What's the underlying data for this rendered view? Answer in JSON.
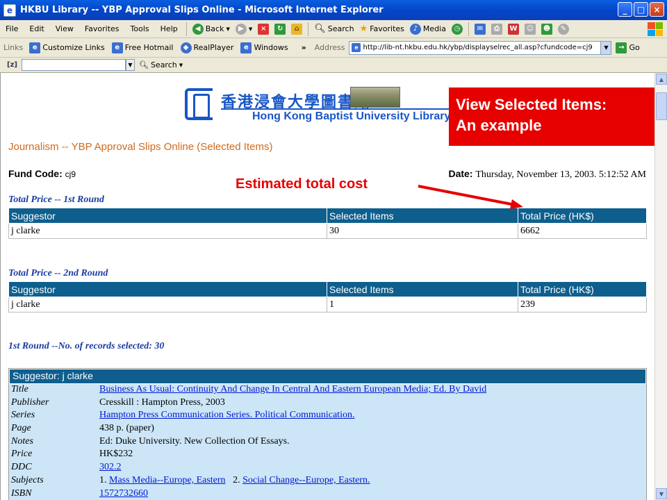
{
  "window": {
    "title": "HKBU Library -- YBP Approval Slips Online - Microsoft Internet Explorer",
    "controls": [
      "_",
      "□",
      "×"
    ]
  },
  "menubar": {
    "menus": [
      "File",
      "Edit",
      "View",
      "Favorites",
      "Tools",
      "Help"
    ],
    "toolbar": {
      "back": "Back",
      "search": "Search",
      "favorites": "Favorites",
      "media": "Media"
    }
  },
  "linksbar": {
    "label": "Links",
    "links": [
      "Customize Links",
      "Free Hotmail",
      "RealPlayer",
      "Windows"
    ],
    "address_label": "Address",
    "address": "http://lib-nt.hkbu.edu.hk/ybp/displayselrec_all.asp?cfundcode=cj9",
    "go": "Go"
  },
  "searchbar": {
    "logo": "[z]",
    "search_label": "Search"
  },
  "header": {
    "chinese_name": "香港浸會大學圖書館",
    "english_name": "Hong Kong Baptist University Library"
  },
  "callout": {
    "line1": "View Selected Items:",
    "line2": "An example"
  },
  "cost_label": "Estimated total cost",
  "page": {
    "title": "Journalism -- YBP Approval Slips Online (Selected Items)",
    "fund_code_label": "Fund Code:",
    "fund_code": "cj9",
    "date_label": "Date:",
    "date": "Thursday, November 13, 2003. 5:12:52 AM"
  },
  "round1": {
    "title": "Total Price -- 1st Round",
    "headers": [
      "Suggestor",
      "Selected Items",
      "Total Price (HK$)"
    ],
    "rows": [
      [
        "j clarke",
        "30",
        "6662"
      ]
    ]
  },
  "round2": {
    "title": "Total Price -- 2nd Round",
    "headers": [
      "Suggestor",
      "Selected Items",
      "Total Price (HK$)"
    ],
    "rows": [
      [
        "j clarke",
        "1",
        "239"
      ]
    ]
  },
  "records": {
    "title": "1st Round --No. of records selected: 30",
    "suggestor_header": "Suggestor: j clarke",
    "fields": {
      "title_label": "Title",
      "title": "Business As Usual: Continuity And Change In Central And Eastern European Media; Ed. By David",
      "publisher_label": "Publisher",
      "publisher": "Cresskill : Hampton Press, 2003",
      "series_label": "Series",
      "series": "Hampton Press Communication Series. Political Communication.",
      "page_label": "Page",
      "page": "438 p. (paper)",
      "notes_label": "Notes",
      "notes": "Ed: Duke University. New Collection Of Essays.",
      "price_label": "Price",
      "price": "HK$232",
      "ddc_label": "DDC",
      "ddc": "302.2",
      "subjects_label": "Subjects",
      "subject1_num": "1.",
      "subject1": "Mass Media--Europe, Eastern",
      "subject2_num": "2.",
      "subject2": "Social Change--Europe, Eastern.",
      "isbn_label": "ISBN",
      "isbn": "1572732660"
    }
  },
  "colors": {
    "table_header": "#0e5f8e",
    "callout": "#e60000",
    "page_title": "#d06a1d",
    "section_title": "#1a3ca0",
    "record_bg": "#cce6f7"
  }
}
